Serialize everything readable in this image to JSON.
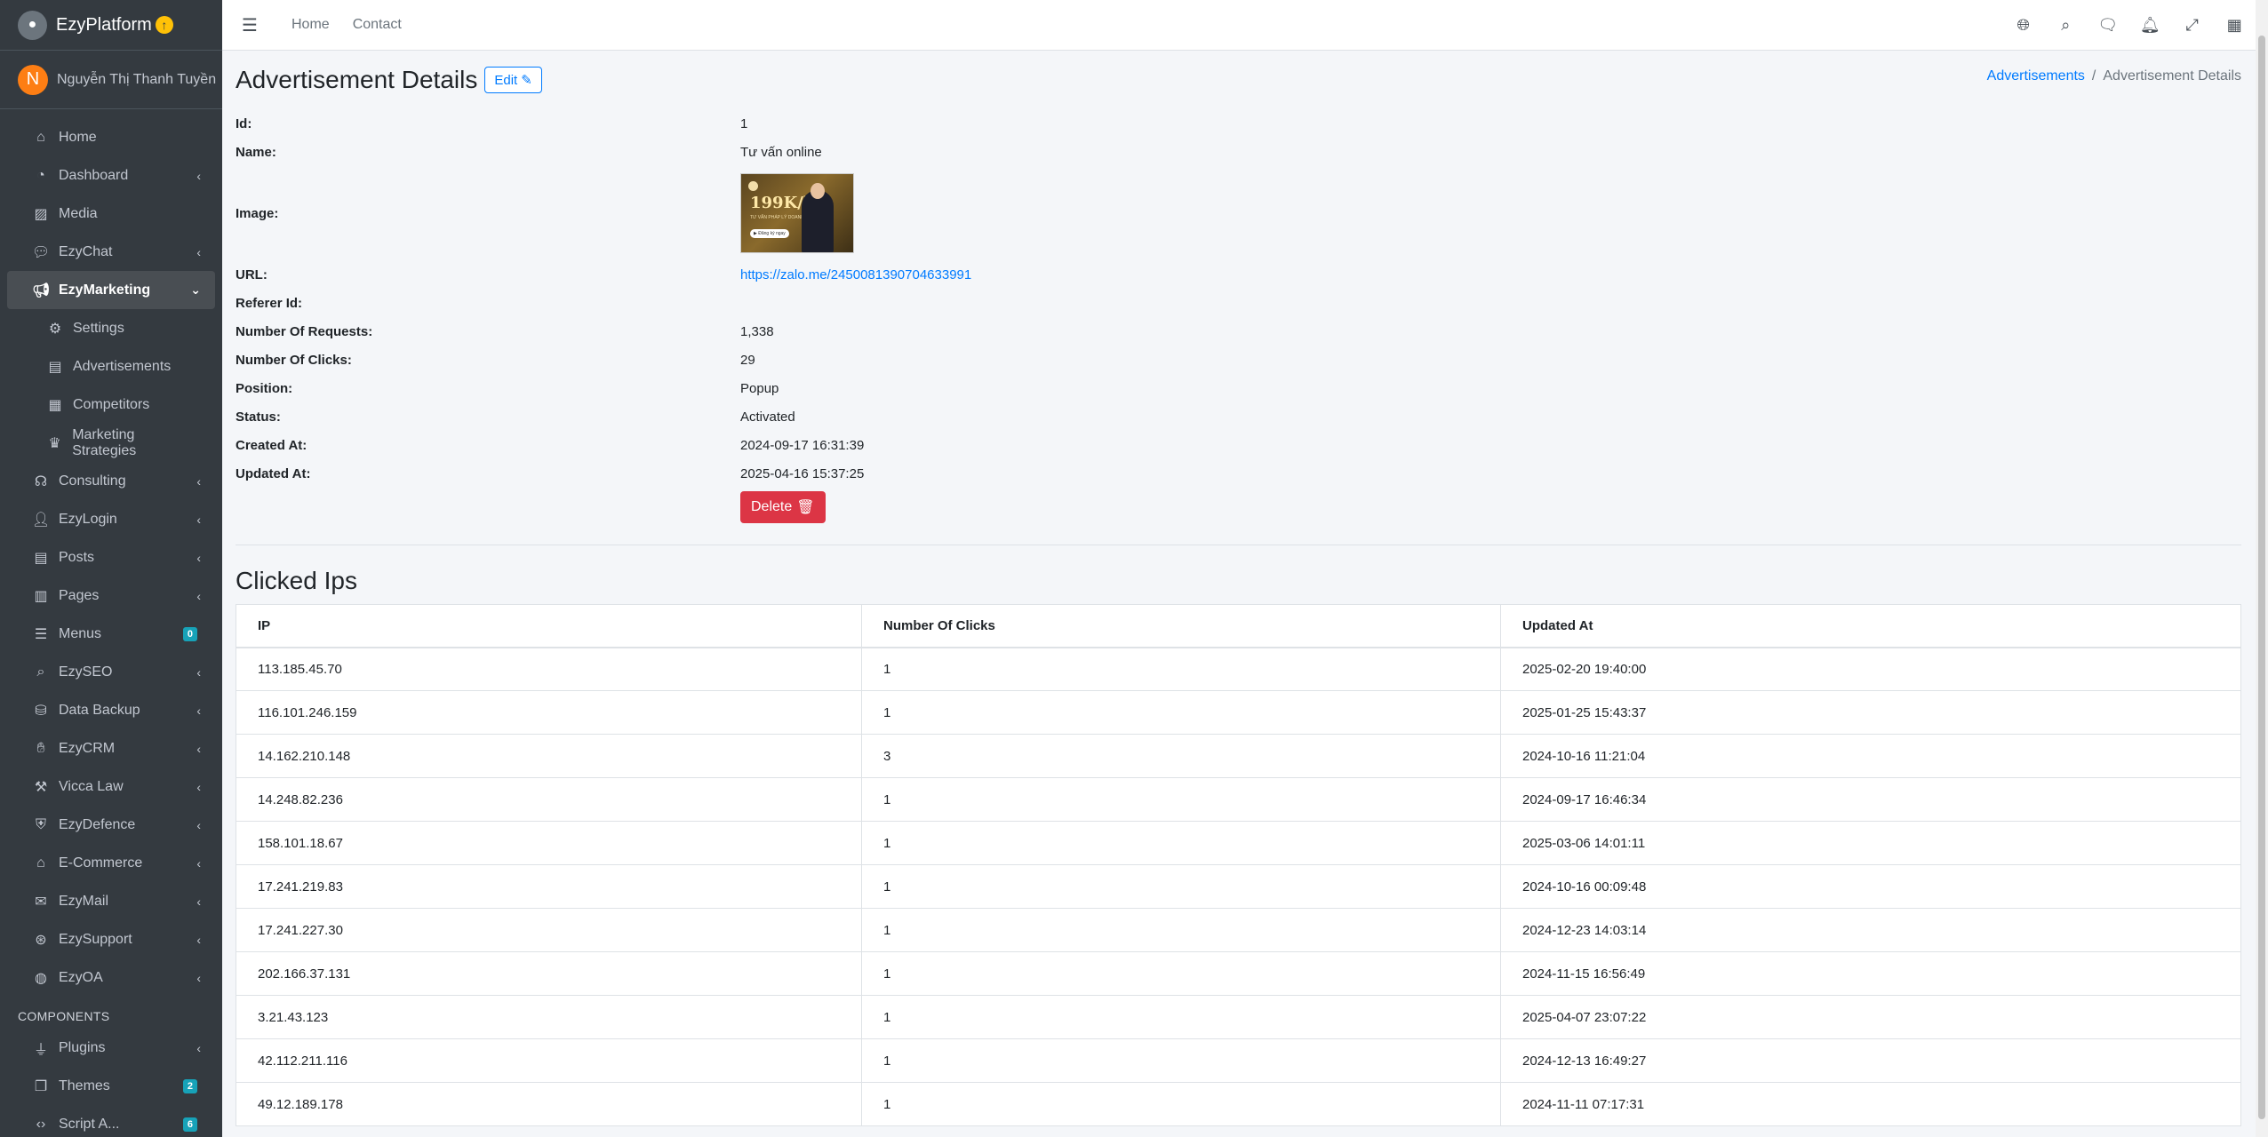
{
  "brand": {
    "name": "EzyPlatform",
    "logo_icon": "platform-logo-icon"
  },
  "user": {
    "initial": "N",
    "name": "Nguyễn Thị Thanh Tuyền"
  },
  "sidebar": {
    "items": [
      {
        "label": "Home",
        "icon": "home-icon",
        "arrow": ""
      },
      {
        "label": "Dashboard",
        "icon": "dashboard-icon",
        "arrow": "‹"
      },
      {
        "label": "Media",
        "icon": "image-icon",
        "arrow": ""
      },
      {
        "label": "EzyChat",
        "icon": "chat-icon",
        "arrow": "‹"
      },
      {
        "label": "EzyMarketing",
        "icon": "megaphone-icon",
        "arrow": "⌄"
      },
      {
        "label": "Settings",
        "icon": "gear-icon",
        "arrow": ""
      },
      {
        "label": "Advertisements",
        "icon": "ad-icon",
        "arrow": ""
      },
      {
        "label": "Competitors",
        "icon": "grid-icon",
        "arrow": ""
      },
      {
        "label": "Marketing Strategies",
        "icon": "chess-icon",
        "arrow": ""
      },
      {
        "label": "Consulting",
        "icon": "headset-icon",
        "arrow": "‹"
      },
      {
        "label": "EzyLogin",
        "icon": "user-lock-icon",
        "arrow": "‹"
      },
      {
        "label": "Posts",
        "icon": "newspaper-icon",
        "arrow": "‹"
      },
      {
        "label": "Pages",
        "icon": "pages-icon",
        "arrow": "‹"
      },
      {
        "label": "Menus",
        "icon": "menu-icon",
        "badge": "0"
      },
      {
        "label": "EzySEO",
        "icon": "search-icon",
        "arrow": "‹"
      },
      {
        "label": "Data Backup",
        "icon": "database-icon",
        "arrow": "‹"
      },
      {
        "label": "EzyCRM",
        "icon": "handshake-icon",
        "arrow": "‹"
      },
      {
        "label": "Vicca Law",
        "icon": "gavel-icon",
        "arrow": "‹"
      },
      {
        "label": "EzyDefence",
        "icon": "shield-icon",
        "arrow": "‹"
      },
      {
        "label": "E-Commerce",
        "icon": "basket-icon",
        "arrow": "‹"
      },
      {
        "label": "EzyMail",
        "icon": "envelope-icon",
        "arrow": "‹"
      },
      {
        "label": "EzySupport",
        "icon": "lifebuoy-icon",
        "arrow": "‹"
      },
      {
        "label": "EzyOA",
        "icon": "globe-icon",
        "arrow": "‹"
      }
    ],
    "components_header": "COMPONENTS",
    "component_items": [
      {
        "label": "Plugins",
        "icon": "plug-icon",
        "arrow": "‹"
      },
      {
        "label": "Themes",
        "icon": "copy-icon",
        "badge": "2"
      },
      {
        "label": "Script A...",
        "icon": "code-icon",
        "badge": "6"
      }
    ]
  },
  "topbar": {
    "home_label": "Home",
    "contact_label": "Contact",
    "icons": [
      "globe-icon",
      "search-icon",
      "comments-icon",
      "bell-icon",
      "expand-icon",
      "apps-icon"
    ]
  },
  "page": {
    "title": "Advertisement Details",
    "edit_label": "Edit",
    "breadcrumb": {
      "parent": "Advertisements",
      "current": "Advertisement Details"
    }
  },
  "details": {
    "id_label": "Id:",
    "id": "1",
    "name_label": "Name:",
    "name": "Tư vấn online",
    "image_label": "Image:",
    "image_text": {
      "price": "199K/h",
      "sub": "TƯ VẤN PHÁP LÝ DOANH",
      "cta": "▶ Đăng ký ngay"
    },
    "url_label": "URL:",
    "url": "https://zalo.me/2450081390704633991",
    "referer_label": "Referer Id:",
    "referer": "",
    "requests_label": "Number Of Requests:",
    "requests": "1,338",
    "clicks_label": "Number Of Clicks:",
    "clicks": "29",
    "position_label": "Position:",
    "position": "Popup",
    "status_label": "Status:",
    "status": "Activated",
    "created_label": "Created At:",
    "created": "2024-09-17 16:31:39",
    "updated_label": "Updated At:",
    "updated": "2025-04-16 15:37:25",
    "delete_label": "Delete"
  },
  "clicked_ips": {
    "title": "Clicked Ips",
    "columns": [
      "IP",
      "Number Of Clicks",
      "Updated At"
    ],
    "rows": [
      [
        "113.185.45.70",
        "1",
        "2025-02-20 19:40:00"
      ],
      [
        "116.101.246.159",
        "1",
        "2025-01-25 15:43:37"
      ],
      [
        "14.162.210.148",
        "3",
        "2024-10-16 11:21:04"
      ],
      [
        "14.248.82.236",
        "1",
        "2024-09-17 16:46:34"
      ],
      [
        "158.101.18.67",
        "1",
        "2025-03-06 14:01:11"
      ],
      [
        "17.241.219.83",
        "1",
        "2024-10-16 00:09:48"
      ],
      [
        "17.241.227.30",
        "1",
        "2024-12-23 14:03:14"
      ],
      [
        "202.166.37.131",
        "1",
        "2024-11-15 16:56:49"
      ],
      [
        "3.21.43.123",
        "1",
        "2025-04-07 23:07:22"
      ],
      [
        "42.112.211.116",
        "1",
        "2024-12-13 16:49:27"
      ],
      [
        "49.12.189.178",
        "1",
        "2024-11-11 07:17:31"
      ]
    ]
  },
  "colors": {
    "sidebar": "#343a40",
    "primary": "#007bff",
    "danger": "#dc3545",
    "info": "#17a2b8",
    "avatar": "#fd7e14"
  }
}
